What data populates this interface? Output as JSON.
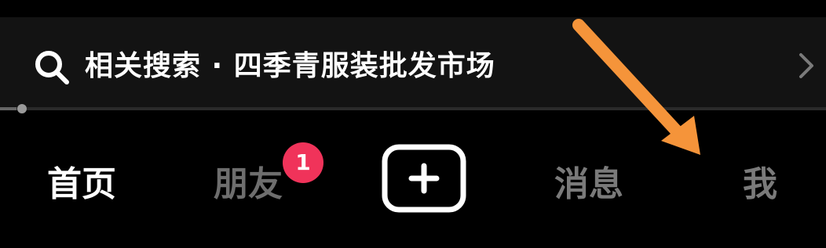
{
  "search": {
    "text": "相关搜索 · 四季青服装批发市场",
    "icon": "search-icon",
    "chevron_icon": "chevron-right-icon"
  },
  "progress": {
    "value": 0.02
  },
  "tabs": {
    "home": "首页",
    "friends": "朋友",
    "friends_badge": "1",
    "create_icon": "plus-icon",
    "messages": "消息",
    "me": "我"
  },
  "colors": {
    "background": "#000000",
    "search_bar": "#131313",
    "badge": "#f0335a",
    "annotation_arrow": "#f5943a"
  },
  "annotation": {
    "icon": "orange-arrow-icon"
  }
}
